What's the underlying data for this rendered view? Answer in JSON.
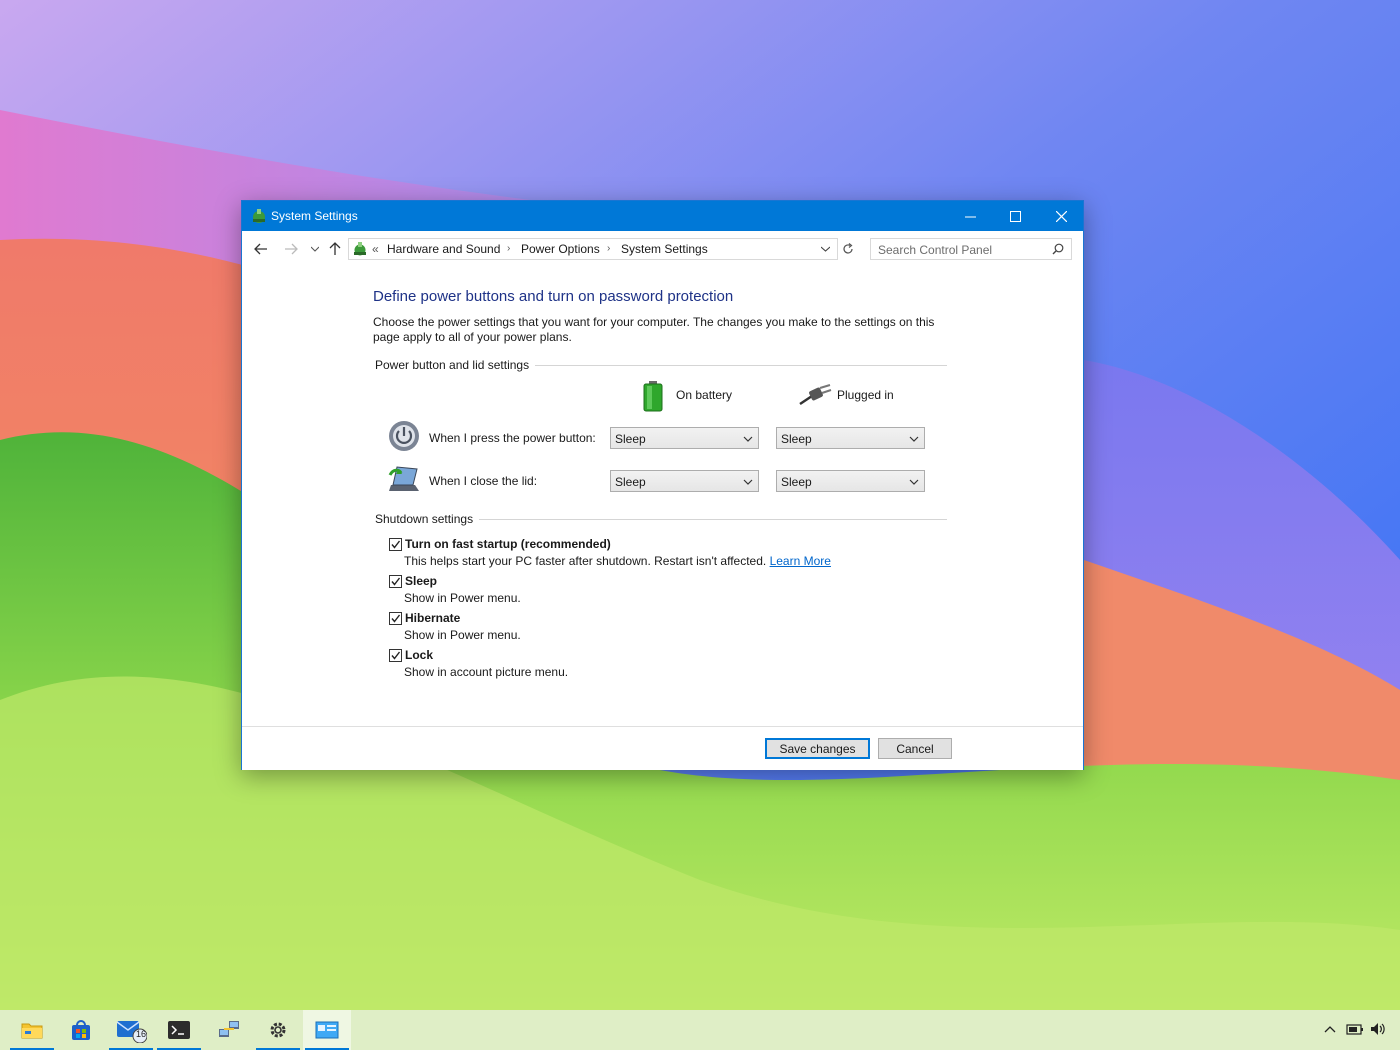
{
  "window": {
    "title": "System Settings",
    "controls": {
      "minimize": "minimize",
      "maximize": "maximize",
      "close": "close"
    }
  },
  "address_bar": {
    "overflow": "«",
    "crumbs": [
      "Hardware and Sound",
      "Power Options",
      "System Settings"
    ]
  },
  "search": {
    "placeholder": "Search Control Panel"
  },
  "page": {
    "heading": "Define power buttons and turn on password protection",
    "description": "Choose the power settings that you want for your computer. The changes you make to the settings on this page apply to all of your power plans."
  },
  "power_section": {
    "label": "Power button and lid settings",
    "columns": {
      "battery": "On battery",
      "plugged": "Plugged in"
    },
    "rows": [
      {
        "label": "When I press the power button:",
        "battery": "Sleep",
        "plugged": "Sleep"
      },
      {
        "label": "When I close the lid:",
        "battery": "Sleep",
        "plugged": "Sleep"
      }
    ]
  },
  "shutdown_section": {
    "label": "Shutdown settings",
    "options": [
      {
        "title": "Turn on fast startup (recommended)",
        "subtitle": "This helps start your PC faster after shutdown. Restart isn't affected.",
        "link": "Learn More",
        "checked": true
      },
      {
        "title": "Sleep",
        "subtitle": "Show in Power menu.",
        "checked": true
      },
      {
        "title": "Hibernate",
        "subtitle": "Show in Power menu.",
        "checked": true
      },
      {
        "title": "Lock",
        "subtitle": "Show in account picture menu.",
        "checked": true
      }
    ]
  },
  "footer": {
    "save": "Save changes",
    "cancel": "Cancel"
  },
  "taskbar": {
    "apps": [
      "file-explorer",
      "microsoft-store",
      "mail",
      "terminal",
      "network-settings",
      "settings",
      "control-panel"
    ],
    "mail_badge": "16"
  },
  "colors": {
    "accent": "#0078d7",
    "heading": "#1e3287",
    "link": "#0066cc"
  }
}
